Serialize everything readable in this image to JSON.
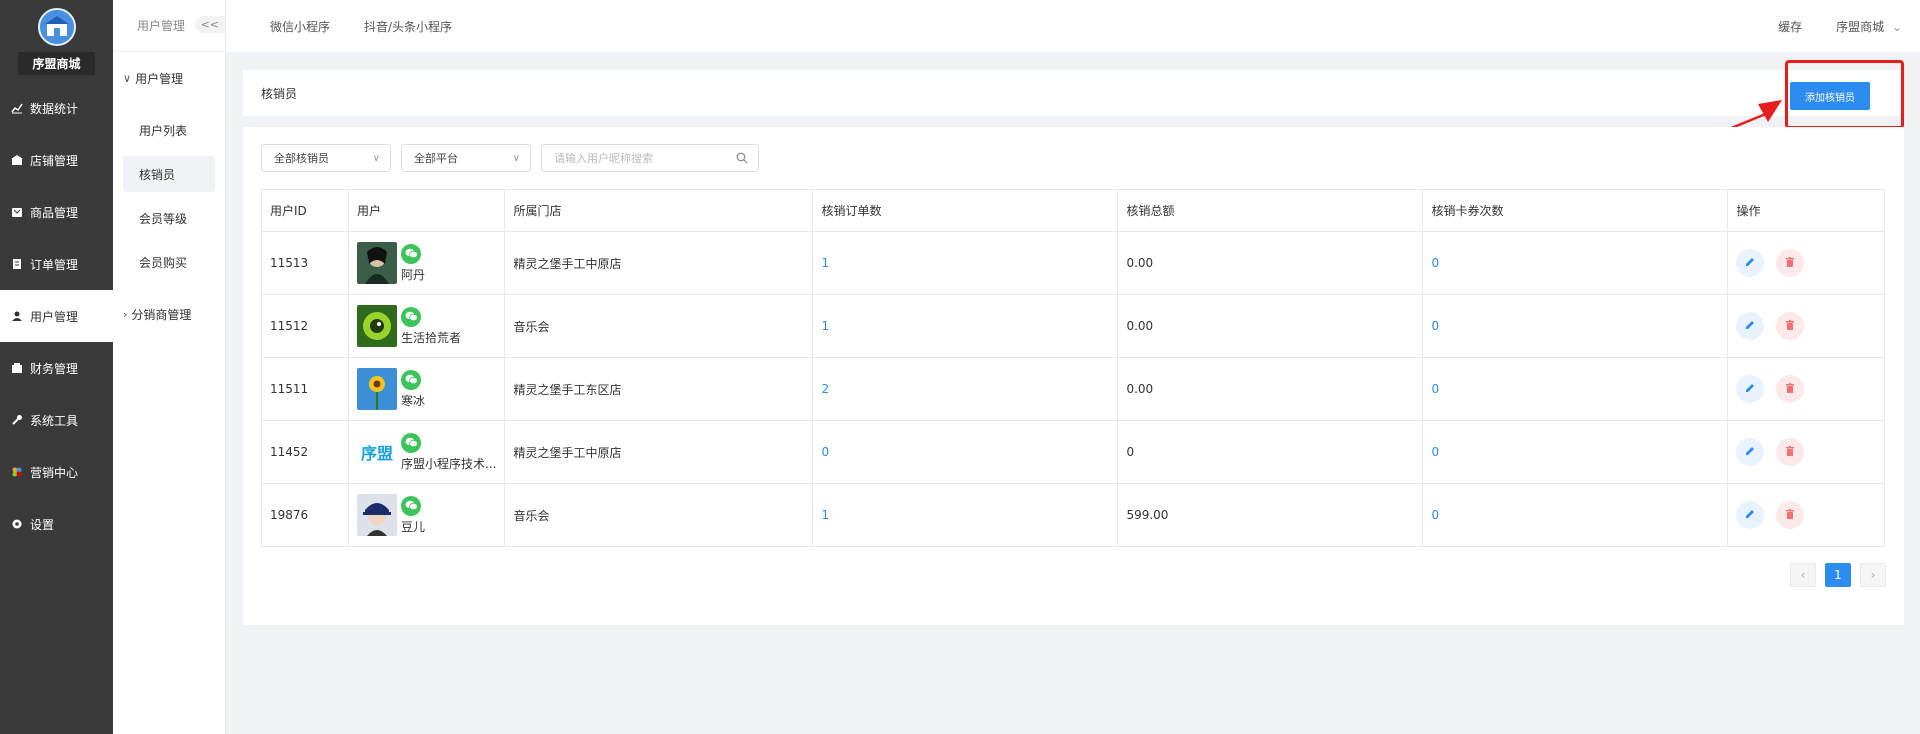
{
  "shop": {
    "name": "序盟商城"
  },
  "nav": [
    {
      "label": "数据统计",
      "icon": "chart-icon"
    },
    {
      "label": "店铺管理",
      "icon": "store-icon"
    },
    {
      "label": "商品管理",
      "icon": "goods-icon"
    },
    {
      "label": "订单管理",
      "icon": "order-icon"
    },
    {
      "label": "用户管理",
      "icon": "user-icon",
      "active": true
    },
    {
      "label": "财务管理",
      "icon": "finance-icon"
    },
    {
      "label": "系统工具",
      "icon": "wrench-icon"
    },
    {
      "label": "营销中心",
      "icon": "marketing-icon"
    },
    {
      "label": "设置",
      "icon": "gear-icon"
    }
  ],
  "subnav": {
    "header": "用户管理",
    "collapse": "<<",
    "group1": "用户管理",
    "items": [
      "用户列表",
      "核销员",
      "会员等级",
      "会员购买"
    ],
    "group2": "分销商管理"
  },
  "topbar": {
    "tabs": [
      "微信小程序",
      "抖音/头条小程序"
    ],
    "cache": "缓存",
    "account": "序盟商城"
  },
  "page": {
    "title": "核销员",
    "add_button": "添加核销员"
  },
  "filters": {
    "staff": "全部核销员",
    "platform": "全部平台",
    "search_placeholder": "请输入用户昵称搜索"
  },
  "table": {
    "headers": [
      "用户ID",
      "用户",
      "所属门店",
      "核销订单数",
      "核销总额",
      "核销卡券次数",
      "操作"
    ],
    "rows": [
      {
        "id": "11513",
        "name": "阿丹",
        "store": "精灵之堡手工中原店",
        "orders": "1",
        "total": "0.00",
        "coupons": "0",
        "avatar": "dark"
      },
      {
        "id": "11512",
        "name": "生活拾荒者",
        "store": "音乐会",
        "orders": "1",
        "total": "0.00",
        "coupons": "0",
        "avatar": "green"
      },
      {
        "id": "11511",
        "name": "寒冰",
        "store": "精灵之堡手工东区店",
        "orders": "2",
        "total": "0.00",
        "coupons": "0",
        "avatar": "flower"
      },
      {
        "id": "11452",
        "name": "序盟小程序技术...",
        "store": "精灵之堡手工中原店",
        "orders": "0",
        "total": "0",
        "coupons": "0",
        "avatar": "text",
        "avatar_text": "序盟"
      },
      {
        "id": "19876",
        "name": "豆儿",
        "store": "音乐会",
        "orders": "1",
        "total": "599.00",
        "coupons": "0",
        "avatar": "girl"
      }
    ]
  },
  "pagination": {
    "prev": "‹",
    "current": "1",
    "next": "›"
  },
  "colors": {
    "primary": "#2d8cf0",
    "sidebar": "#3a3a3a",
    "wechat": "#3cc45a",
    "highlight": "#e61e1e"
  }
}
